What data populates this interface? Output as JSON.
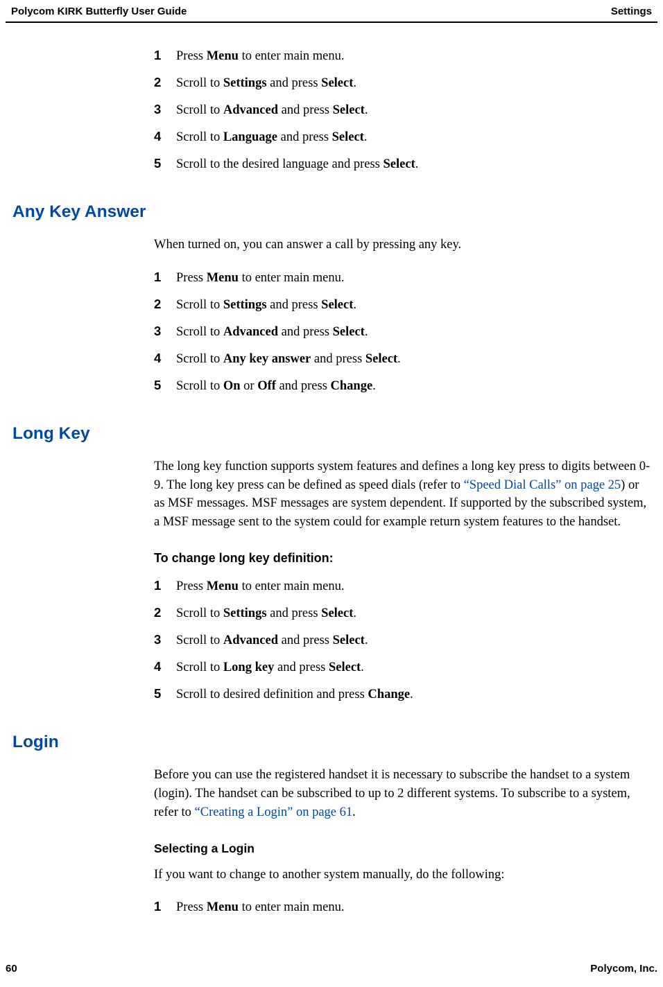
{
  "header": {
    "title": "Polycom KIRK Butterfly User Guide",
    "section": "Settings"
  },
  "sections": {
    "lang_steps": [
      {
        "n": "1",
        "pre": "Press ",
        "b1": "Menu",
        "mid": " to enter main menu.",
        "b2": "",
        "post": ""
      },
      {
        "n": "2",
        "pre": "Scroll to ",
        "b1": "Settings",
        "mid": " and press ",
        "b2": "Select",
        "post": "."
      },
      {
        "n": "3",
        "pre": "Scroll to ",
        "b1": "Advanced",
        "mid": " and press ",
        "b2": "Select",
        "post": "."
      },
      {
        "n": "4",
        "pre": "Scroll to ",
        "b1": "Language",
        "mid": " and press ",
        "b2": "Select",
        "post": "."
      },
      {
        "n": "5",
        "pre": "Scroll to the desired language and press ",
        "b1": "Select",
        "mid": ".",
        "b2": "",
        "post": ""
      }
    ],
    "anykey": {
      "title": "Any Key Answer",
      "intro": "When turned on, you can answer a call by pressing any key.",
      "steps": [
        {
          "n": "1",
          "pre": "Press ",
          "b1": "Menu",
          "mid": " to enter main menu.",
          "b2": "",
          "post": ""
        },
        {
          "n": "2",
          "pre": "Scroll to ",
          "b1": "Settings",
          "mid": " and press ",
          "b2": "Select",
          "post": "."
        },
        {
          "n": "3",
          "pre": "Scroll to ",
          "b1": "Advanced",
          "mid": " and press ",
          "b2": "Select",
          "post": "."
        },
        {
          "n": "4",
          "pre": "Scroll to ",
          "b1": "Any key answer",
          "mid": " and press ",
          "b2": "Select",
          "post": "."
        },
        {
          "n": "5",
          "pre": "Scroll to ",
          "b1": "On",
          "mid": " or ",
          "b2": "Off",
          "post_b3": " and press ",
          "b3": "Change",
          "post": "."
        }
      ]
    },
    "longkey": {
      "title": "Long Key",
      "p1_pre": "The long key function supports system features and defines a long key press to digits between 0-9. The long key press can be defined as speed dials (refer to ",
      "p1_link": "“Speed Dial Calls” on page 25",
      "p1_post": ") or as MSF messages. MSF messages are system dependent. If supported by the subscribed system, a MSF message sent to the system could for example return system features to the handset.",
      "subhead": "To change long key definition:",
      "steps": [
        {
          "n": "1",
          "pre": "Press ",
          "b1": "Menu",
          "mid": " to enter main menu.",
          "b2": "",
          "post": ""
        },
        {
          "n": "2",
          "pre": "Scroll to ",
          "b1": "Settings",
          "mid": " and press ",
          "b2": "Select",
          "post": "."
        },
        {
          "n": "3",
          "pre": "Scroll to ",
          "b1": "Advanced",
          "mid": " and press ",
          "b2": "Select",
          "post": "."
        },
        {
          "n": "4",
          "pre": "Scroll to ",
          "b1": "Long key",
          "mid": " and press ",
          "b2": "Select",
          "post": "."
        },
        {
          "n": "5",
          "pre": "Scroll to desired definition and press ",
          "b1": "Change",
          "mid": ".",
          "b2": "",
          "post": ""
        }
      ]
    },
    "login": {
      "title": "Login",
      "p1_pre": "Before you can use the registered handset it is necessary to subscribe the handset to a system (login). The handset can be subscribed to up to 2 different systems. To subscribe to a system, refer to ",
      "p1_link": "“Creating a Login” on page 61",
      "p1_post": ".",
      "subhead": "Selecting a Login",
      "intro2": "If you want to change to another system manually, do the following:",
      "steps": [
        {
          "n": "1",
          "pre": "Press ",
          "b1": "Menu",
          "mid": " to enter main menu.",
          "b2": "",
          "post": ""
        }
      ]
    }
  },
  "footer": {
    "page": "60",
    "company": "Polycom, Inc."
  }
}
